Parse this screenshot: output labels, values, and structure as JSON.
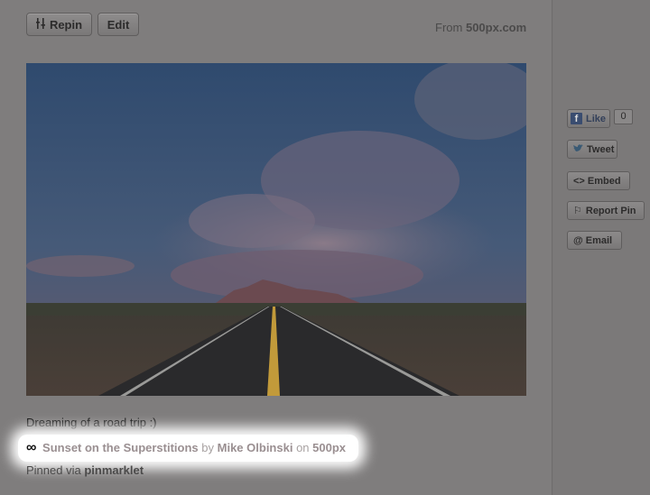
{
  "actions": {
    "repin_label": "Repin",
    "edit_label": "Edit"
  },
  "source": {
    "prefix": "From",
    "domain": "500px.com"
  },
  "pin": {
    "description": "Dreaming of a road trip :)",
    "attribution": {
      "title": "Sunset on the Superstitions",
      "by_word": "by",
      "author": "Mike Olbinski",
      "on_word": "on",
      "site": "500px"
    },
    "pinned_prefix": "Pinned via",
    "pinned_via": "pinmarklet"
  },
  "share": {
    "like_label": "Like",
    "like_count": "0",
    "tweet_label": "Tweet",
    "embed_label": "<> Embed",
    "report_label": "Report Pin",
    "email_label": "Email"
  },
  "icons": {
    "repin": "pin-icon",
    "infinity": "infinity-icon",
    "facebook": "facebook-icon",
    "twitter": "twitter-bird-icon",
    "flag": "flag-icon",
    "email": "at-icon"
  },
  "colors": {
    "overlay": "#7f7d7d",
    "highlight": "#ffffff",
    "link": "#9a8f91"
  }
}
